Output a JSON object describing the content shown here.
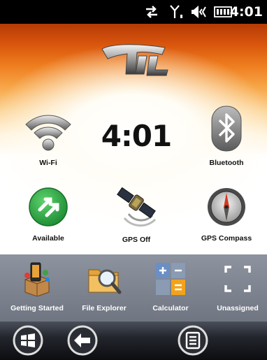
{
  "status_bar": {
    "time": "4:01",
    "icons": [
      "sync-arrows-icon",
      "signal-antenna-icon",
      "volume-icon",
      "battery-icon"
    ]
  },
  "home": {
    "logo_icon": "brand-logo-icon",
    "clock": "4:01",
    "tiles": [
      {
        "label": "Wi-Fi",
        "icon": "wifi-icon"
      },
      {
        "label": "Bluetooth",
        "icon": "bluetooth-icon"
      },
      {
        "label": "Available",
        "icon": "available-status-icon"
      },
      {
        "label": "GPS Off",
        "icon": "gps-satellite-icon"
      },
      {
        "label": "GPS Compass",
        "icon": "compass-icon"
      }
    ]
  },
  "tray": {
    "items": [
      {
        "label": "Getting Started",
        "icon": "getting-started-icon"
      },
      {
        "label": "File Explorer",
        "icon": "file-explorer-icon"
      },
      {
        "label": "Calculator",
        "icon": "calculator-icon"
      },
      {
        "label": "Unassigned",
        "icon": "unassigned-icon"
      }
    ]
  },
  "bottom_bar": {
    "buttons": [
      "windows-start-icon",
      "back-arrow-icon",
      "menu-icon"
    ]
  },
  "colors": {
    "accent_orange": "#ee7d1e",
    "tray_gray": "#7d838f",
    "available_green": "#2ea84a",
    "bluetooth_gray": "#8a8a8a"
  }
}
